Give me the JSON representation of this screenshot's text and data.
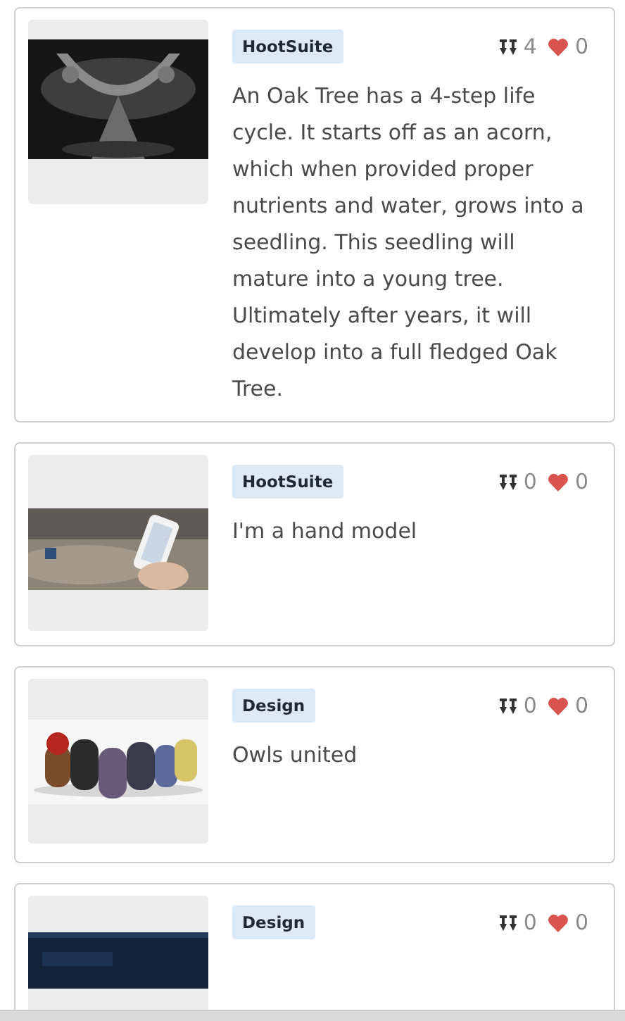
{
  "posts": [
    {
      "kind": "picture",
      "tag": "HootSuite",
      "pins": "4",
      "likes": "0",
      "text": "An Oak Tree has a 4-step life cycle. It starts off as an acorn, which when provided proper nutrients and water, grows into a seedling. This seedling will mature into a young tree. Ultimately after years, it will develop into a full fledged Oak Tree."
    },
    {
      "kind": "picture",
      "tag": "HootSuite",
      "pins": "0",
      "likes": "0",
      "text": "I'm a hand model"
    },
    {
      "kind": "picture",
      "tag": "Design",
      "pins": "0",
      "likes": "0",
      "text": "Owls united"
    },
    {
      "kind": "picture",
      "tag": "Design",
      "pins": "0",
      "likes": "0"
    }
  ]
}
